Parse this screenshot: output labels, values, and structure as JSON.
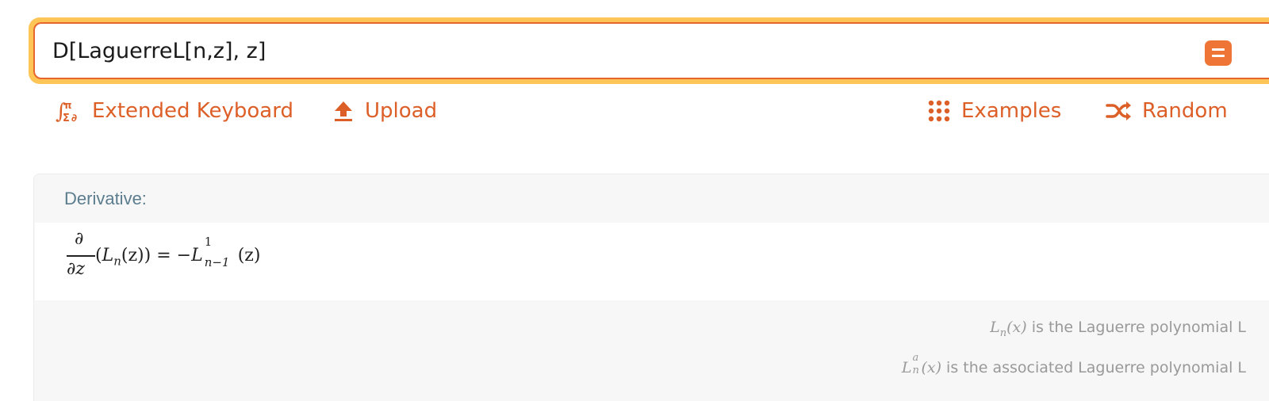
{
  "search": {
    "query": "D[LaguerreL[n,z], z]",
    "compute_icon": "equals-icon"
  },
  "toolbar": {
    "keyboard_label": "Extended Keyboard",
    "keyboard_icon": "math-symbols-icon",
    "upload_label": "Upload",
    "upload_icon": "upload-arrow-icon",
    "examples_label": "Examples",
    "examples_icon": "grid-dots-icon",
    "random_label": "Random",
    "random_icon": "shuffle-icon"
  },
  "pod": {
    "title": "Derivative:",
    "formula": {
      "numerator": "∂",
      "denominator": "∂z",
      "lhs_open": "(",
      "lhs_func": "L",
      "lhs_sub": "n",
      "lhs_arg": "(z)",
      "lhs_close": ")",
      "equals": " = −",
      "rhs_func": "L",
      "rhs_sup": "1",
      "rhs_sub": "n−1",
      "rhs_arg": "(z)"
    },
    "notes": [
      {
        "symbol": "L",
        "symbol_sub": "n",
        "symbol_sup": "",
        "arg": "(x)",
        "text": " is the Laguerre polynomial L"
      },
      {
        "symbol": "L",
        "symbol_sub": "n",
        "symbol_sup": "a",
        "arg": "(x)",
        "text": " is the associated Laguerre polynomial L"
      }
    ]
  },
  "colors": {
    "accent": "#dd5f28",
    "search_glow": "#ffc556",
    "search_border": "#e8662c",
    "pod_title": "#5b7d8e",
    "footnote": "#999999"
  }
}
